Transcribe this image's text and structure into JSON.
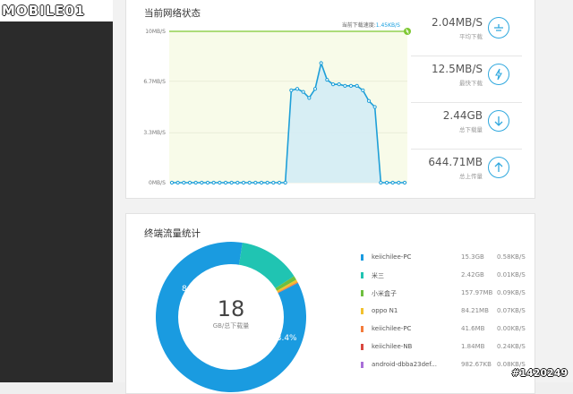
{
  "logo": "MOBILE01",
  "watermark": "#1420249",
  "network_panel": {
    "title": "当前网络状态",
    "speed_label": "当前下载速度:",
    "speed_value": "1.45KB/S",
    "y_ticks": [
      "10MB/S",
      "6.7MB/S",
      "3.3MB/S",
      "0MB/S"
    ]
  },
  "stats": [
    {
      "value": "2.04MB/S",
      "label": "平均下载",
      "icon": "download-speed-icon"
    },
    {
      "value": "12.5MB/S",
      "label": "最快下载",
      "icon": "lightning-icon"
    },
    {
      "value": "2.44GB",
      "label": "总下载量",
      "icon": "download-arrow-icon"
    },
    {
      "value": "644.71MB",
      "label": "总上传量",
      "icon": "upload-arrow-icon"
    }
  ],
  "traffic_panel": {
    "title": "终端流量统计",
    "center_value": "18",
    "center_label": "GB/总下载量",
    "slice_labels": [
      "84.9%",
      "13.4%"
    ]
  },
  "devices": [
    {
      "name": "keiichilee-PC",
      "size": "15.3GB",
      "speed": "0.58KB/S",
      "color": "#1a9be0"
    },
    {
      "name": "米三",
      "size": "2.42GB",
      "speed": "0.01KB/S",
      "color": "#20c4b2"
    },
    {
      "name": "小米盒子",
      "size": "157.97MB",
      "speed": "0.09KB/S",
      "color": "#6fbf3f"
    },
    {
      "name": "oppo N1",
      "size": "84.21MB",
      "speed": "0.07KB/S",
      "color": "#f2c12e"
    },
    {
      "name": "keiichilee-PC",
      "size": "41.6MB",
      "speed": "0.00KB/S",
      "color": "#f47c3c"
    },
    {
      "name": "keiichilee-NB",
      "size": "1.84MB",
      "speed": "0.24KB/S",
      "color": "#d9473f"
    },
    {
      "name": "android-dbba23def...",
      "size": "982.67KB",
      "speed": "0.08KB/S",
      "color": "#a86fd8"
    }
  ],
  "chart_data": [
    {
      "type": "area",
      "title": "当前网络状态",
      "ylabel": "",
      "y_ticks": [
        "10MB/S",
        "6.7MB/S",
        "3.3MB/S",
        "0MB/S"
      ],
      "ylim": [
        0,
        10
      ],
      "reference_line": 10,
      "values": [
        0,
        0,
        0,
        0,
        0,
        0,
        0,
        0,
        0,
        0,
        0,
        0,
        0,
        0,
        0,
        0,
        0,
        0,
        0,
        0,
        6.1,
        6.2,
        6.0,
        5.6,
        6.2,
        7.9,
        6.8,
        6.5,
        6.5,
        6.4,
        6.4,
        6.4,
        6.1,
        5.4,
        5.0,
        0,
        0,
        0,
        0,
        0
      ]
    },
    {
      "type": "pie",
      "title": "终端流量统计",
      "categories": [
        "keiichilee-PC",
        "米三",
        "小米盒子",
        "oppo N1",
        "keiichilee-PC",
        "keiichilee-NB",
        "android-dbba23def..."
      ],
      "values": [
        84.9,
        13.4,
        0.9,
        0.5,
        0.23,
        0.01,
        0.01
      ]
    }
  ]
}
